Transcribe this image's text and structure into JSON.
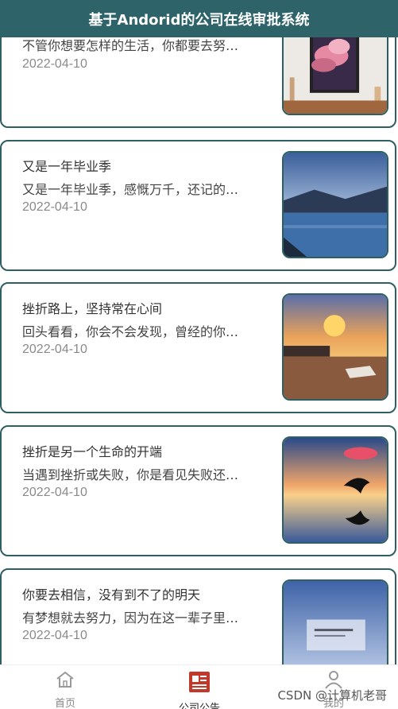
{
  "header": {
    "title": "基于Andorid的公司在线审批系统"
  },
  "announcements": [
    {
      "title": "",
      "desc": "不管你想要怎样的生活，你都要去努…",
      "date": "2022-04-10",
      "image": "pink-clouds"
    },
    {
      "title": "又是一年毕业季",
      "desc": "又是一年毕业季，感慨万千，还记的…",
      "date": "2022-04-10",
      "image": "mountain-lake"
    },
    {
      "title": "挫折路上，坚持常在心间",
      "desc": "回头看看，你会不会发现，曾经的你…",
      "date": "2022-04-10",
      "image": "sunset-river"
    },
    {
      "title": "挫折是另一个生命的开端",
      "desc": "当遇到挫折或失败，你是看见失败还…",
      "date": "2022-04-10",
      "image": "dolphin-sunset"
    },
    {
      "title": "你要去相信，没有到不了的明天",
      "desc": "有梦想就去努力，因为在这一辈子里…",
      "date": "2022-04-10",
      "image": "blue-book"
    }
  ],
  "tabbar": {
    "items": [
      {
        "label": "首页",
        "icon": "home-icon",
        "active": false
      },
      {
        "label": "公司公告",
        "icon": "announcement-icon",
        "active": true
      },
      {
        "label": "我的",
        "icon": "user-icon",
        "active": false
      }
    ]
  },
  "watermark": "CSDN @计算机老哥",
  "colors": {
    "header_bg": "#2e6469",
    "border": "#2e5f63",
    "active_icon": "#c0392b"
  }
}
